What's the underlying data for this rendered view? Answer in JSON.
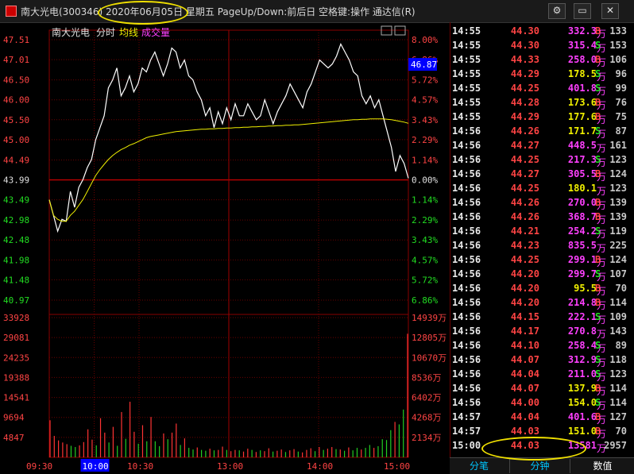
{
  "window": {
    "title": "南大光电(300346) 2020年06月05日 星期五 PageUp/Down:前后日 空格键:操作 通达信(R)",
    "buttons": [
      "⚙",
      "▭",
      "✕"
    ]
  },
  "chart_header": {
    "stock_name": "南大光电",
    "mode": "分时",
    "avg_label": "均线",
    "vol_label": "成交量"
  },
  "price_axis": {
    "left": [
      "47.51",
      "47.01",
      "46.50",
      "46.00",
      "45.50",
      "45.00",
      "44.49",
      "43.99",
      "43.49",
      "42.98",
      "42.48",
      "41.98",
      "41.48",
      "40.97"
    ],
    "right": [
      "8.00%",
      "6.86%",
      "5.72%",
      "4.57%",
      "3.43%",
      "2.29%",
      "1.14%",
      "0.00%",
      "1.14%",
      "2.29%",
      "3.43%",
      "4.57%",
      "5.72%",
      "6.86%"
    ],
    "current_price": "46.87"
  },
  "volume_axis": {
    "left": [
      "33928",
      "29081",
      "24235",
      "19388",
      "14541",
      "9694",
      "4847"
    ],
    "right": [
      "14939万",
      "12805万",
      "10670万",
      "8536万",
      "6402万",
      "4268万",
      "2134万"
    ]
  },
  "time_axis": [
    "09:30",
    "10:00",
    "10:30",
    "13:00",
    "14:00",
    "15:00"
  ],
  "chart_data": {
    "type": "line",
    "x_range": [
      "09:30",
      "15:00"
    ],
    "ylim": [
      40.73,
      47.51
    ],
    "prev_close": 43.99,
    "series": [
      {
        "name": "分时",
        "color": "#ffffff",
        "values": [
          43.49,
          43.1,
          42.7,
          43.0,
          42.95,
          43.7,
          43.3,
          43.8,
          44.0,
          44.3,
          44.5,
          45.0,
          45.3,
          45.6,
          46.3,
          46.5,
          46.8,
          46.1,
          46.3,
          46.6,
          46.2,
          46.4,
          46.8,
          46.7,
          47.0,
          47.2,
          46.9,
          46.6,
          46.9,
          47.3,
          47.2,
          46.8,
          47.0,
          46.6,
          46.5,
          46.2,
          46.0,
          45.6,
          45.8,
          45.3,
          45.7,
          45.4,
          45.8,
          45.5,
          45.9,
          45.6,
          45.6,
          45.9,
          45.7,
          45.5,
          45.6,
          46.0,
          45.7,
          45.4,
          45.7,
          45.9,
          46.1,
          46.4,
          46.2,
          46.0,
          45.8,
          46.2,
          46.4,
          46.7,
          47.0,
          46.9,
          46.8,
          46.9,
          47.1,
          47.4,
          47.2,
          47.0,
          46.7,
          46.6,
          46.1,
          45.9,
          46.1,
          45.8,
          46.0,
          45.6,
          45.2,
          44.8,
          44.2,
          44.6,
          44.4,
          44.03
        ]
      },
      {
        "name": "均线",
        "color": "#f0f000",
        "values": [
          43.49,
          43.1,
          43.0,
          42.95,
          42.95,
          43.1,
          43.2,
          43.35,
          43.5,
          43.7,
          43.9,
          44.1,
          44.25,
          44.38,
          44.5,
          44.6,
          44.68,
          44.75,
          44.8,
          44.86,
          44.9,
          44.95,
          45.0,
          45.05,
          45.08,
          45.1,
          45.12,
          45.14,
          45.16,
          45.18,
          45.2,
          45.21,
          45.22,
          45.23,
          45.24,
          45.25,
          45.26,
          45.26,
          45.27,
          45.27,
          45.28,
          45.28,
          45.29,
          45.29,
          45.3,
          45.3,
          45.31,
          45.31,
          45.32,
          45.32,
          45.33,
          45.33,
          45.34,
          45.34,
          45.35,
          45.35,
          45.36,
          45.36,
          45.37,
          45.37,
          45.38,
          45.39,
          45.4,
          45.41,
          45.42,
          45.43,
          45.44,
          45.45,
          45.46,
          45.47,
          45.48,
          45.49,
          45.5,
          45.5,
          45.51,
          45.51,
          45.52,
          45.52,
          45.52,
          45.52,
          45.51,
          45.5,
          45.48,
          45.46,
          45.44,
          45.41
        ]
      }
    ],
    "volume": {
      "ylim": [
        0,
        33928
      ],
      "values": [
        9000,
        5200,
        4100,
        3600,
        3200,
        2800,
        2500,
        2900,
        3700,
        6800,
        4300,
        2900,
        9500,
        6000,
        3600,
        7400,
        2800,
        11000,
        4500,
        13500,
        6200,
        3300,
        7800,
        3900,
        9800,
        3900,
        2700,
        5800,
        4400,
        6000,
        8200,
        3000,
        4600,
        2300,
        1900,
        2400,
        1800,
        1600,
        2100,
        1700,
        1800,
        2600,
        1800,
        1500,
        1800,
        1700,
        1400,
        2100,
        1800,
        1300,
        1700,
        1500,
        2200,
        1400,
        1600,
        1900,
        1300,
        1700,
        2000,
        1400,
        1200,
        1800,
        2200,
        1500,
        2500,
        1800,
        2100,
        2500,
        2000,
        1900,
        1600,
        2400,
        1700,
        2300,
        1900,
        2300,
        3000,
        2300,
        2700,
        4400,
        4200,
        6600,
        8600,
        8000,
        11600,
        30000
      ],
      "colors_up": [
        1,
        1,
        1,
        1,
        1,
        0,
        0,
        1,
        1,
        1,
        1,
        0,
        1,
        1,
        0,
        1,
        0,
        1,
        0,
        1,
        1,
        0,
        1,
        0,
        1,
        0,
        0,
        1,
        0,
        1,
        1,
        0,
        1,
        0,
        0,
        1,
        0,
        0,
        1,
        0,
        1,
        1,
        0,
        1,
        1,
        0,
        1,
        1,
        0,
        1,
        0,
        1,
        1,
        0,
        1,
        1,
        0,
        1,
        1,
        0,
        1,
        1,
        1,
        0,
        1,
        0,
        1,
        1,
        0,
        1,
        0,
        1,
        0,
        0,
        1,
        0,
        0,
        1,
        0,
        0,
        0,
        0,
        1,
        0,
        0,
        1
      ]
    },
    "grid": true
  },
  "tick_list": {
    "rows": [
      {
        "time": "14:55",
        "price": "44.30",
        "vol": "332.3",
        "dir": "B",
        "num": "133"
      },
      {
        "time": "14:55",
        "price": "44.30",
        "vol": "315.4",
        "dir": "S",
        "num": "153"
      },
      {
        "time": "14:55",
        "price": "44.33",
        "vol": "258.0",
        "dir": "B",
        "num": "106"
      },
      {
        "time": "14:55",
        "price": "44.29",
        "vol": "178.5",
        "dir": "S",
        "num": "96"
      },
      {
        "time": "14:55",
        "price": "44.25",
        "vol": "401.8",
        "dir": "S",
        "num": "99"
      },
      {
        "time": "14:55",
        "price": "44.28",
        "vol": "173.6",
        "dir": "B",
        "num": "76"
      },
      {
        "time": "14:55",
        "price": "44.29",
        "vol": "177.6",
        "dir": "B",
        "num": "75"
      },
      {
        "time": "14:56",
        "price": "44.26",
        "vol": "171.7",
        "dir": "S",
        "num": "87"
      },
      {
        "time": "14:56",
        "price": "44.27",
        "vol": "448.5",
        "dir": "",
        "num": "161"
      },
      {
        "time": "14:56",
        "price": "44.25",
        "vol": "217.3",
        "dir": "S",
        "num": "123"
      },
      {
        "time": "14:56",
        "price": "44.27",
        "vol": "305.5",
        "dir": "B",
        "num": "124"
      },
      {
        "time": "14:56",
        "price": "44.25",
        "vol": "180.1",
        "dir": "",
        "num": "123"
      },
      {
        "time": "14:56",
        "price": "44.26",
        "vol": "270.0",
        "dir": "B",
        "num": "139"
      },
      {
        "time": "14:56",
        "price": "44.26",
        "vol": "368.7",
        "dir": "B",
        "num": "139"
      },
      {
        "time": "14:56",
        "price": "44.21",
        "vol": "254.2",
        "dir": "S",
        "num": "119"
      },
      {
        "time": "14:56",
        "price": "44.23",
        "vol": "835.5",
        "dir": "",
        "num": "225"
      },
      {
        "time": "14:56",
        "price": "44.25",
        "vol": "299.1",
        "dir": "B",
        "num": "124"
      },
      {
        "time": "14:56",
        "price": "44.20",
        "vol": "299.7",
        "dir": "S",
        "num": "107"
      },
      {
        "time": "14:56",
        "price": "44.20",
        "vol": "95.5",
        "dir": "B",
        "num": "70"
      },
      {
        "time": "14:56",
        "price": "44.20",
        "vol": "214.8",
        "dir": "B",
        "num": "114"
      },
      {
        "time": "14:56",
        "price": "44.15",
        "vol": "222.1",
        "dir": "S",
        "num": "109"
      },
      {
        "time": "14:56",
        "price": "44.17",
        "vol": "270.8",
        "dir": "",
        "num": "143"
      },
      {
        "time": "14:56",
        "price": "44.10",
        "vol": "258.4",
        "dir": "S",
        "num": "89"
      },
      {
        "time": "14:56",
        "price": "44.07",
        "vol": "312.9",
        "dir": "S",
        "num": "118"
      },
      {
        "time": "14:56",
        "price": "44.04",
        "vol": "211.0",
        "dir": "S",
        "num": "123"
      },
      {
        "time": "14:56",
        "price": "44.07",
        "vol": "137.9",
        "dir": "B",
        "num": "114"
      },
      {
        "time": "14:56",
        "price": "44.00",
        "vol": "154.0",
        "dir": "S",
        "num": "114"
      },
      {
        "time": "14:57",
        "price": "44.04",
        "vol": "401.6",
        "dir": "B",
        "num": "127"
      },
      {
        "time": "14:57",
        "price": "44.03",
        "vol": "151.0",
        "dir": "B",
        "num": "70"
      },
      {
        "time": "15:00",
        "price": "44.03",
        "vol": "13581",
        "dir": "",
        "num": "2957"
      }
    ],
    "unit": "万"
  },
  "tabs": [
    "分笔",
    "分钟",
    "数值"
  ]
}
